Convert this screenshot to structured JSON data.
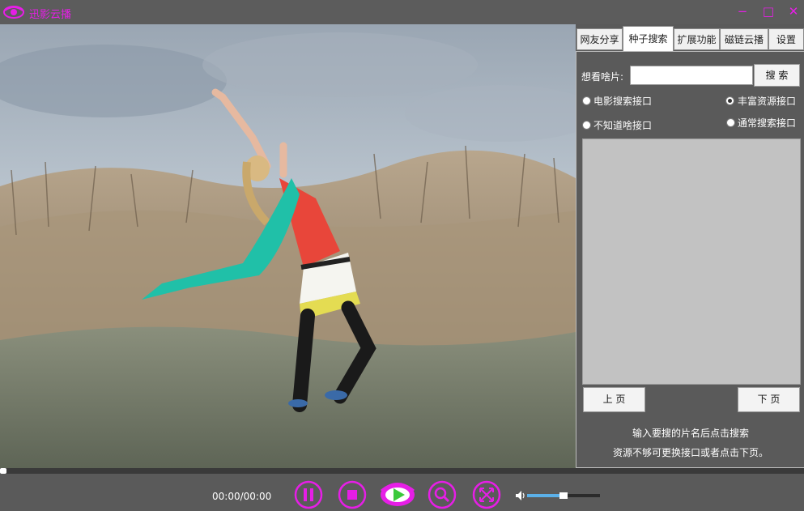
{
  "app": {
    "title": "迅影云播"
  },
  "window": {
    "minimize": "−",
    "maximize": "□",
    "close": "✕"
  },
  "tabs": [
    {
      "label": "网友分享",
      "active": false
    },
    {
      "label": "种子搜索",
      "active": true
    },
    {
      "label": "扩展功能",
      "active": false
    },
    {
      "label": "磁链云播",
      "active": false
    },
    {
      "label": "设置",
      "active": false
    }
  ],
  "search": {
    "label": "想看啥片:",
    "value": "",
    "button": "搜 索"
  },
  "interfaces": [
    {
      "label": "电影搜索接口",
      "selected": false
    },
    {
      "label": "丰富资源接口",
      "selected": true
    },
    {
      "label": "不知道啥接口",
      "selected": false
    },
    {
      "label": "通常搜索接口",
      "selected": false
    }
  ],
  "results": [],
  "pager": {
    "prev": "上 页",
    "next": "下 页"
  },
  "hints": {
    "line1": "输入要搜的片名后点击搜索",
    "line2": "资源不够可更换接口或者点击下页。"
  },
  "player": {
    "time": "00:00/00:00",
    "progress": 0,
    "volume": 0.5
  },
  "icons": {
    "logo": "eye-logo-icon",
    "pause": "pause-icon",
    "stop": "stop-icon",
    "play": "eye-play-icon",
    "search": "search-icon",
    "fullscreen": "fullscreen-icon",
    "volume": "speaker-icon"
  },
  "colors": {
    "accent": "#e61ee6",
    "panel_bg": "#5a5a5a",
    "results_bg": "#c2c2c2",
    "volume": "#5bb0e8"
  }
}
